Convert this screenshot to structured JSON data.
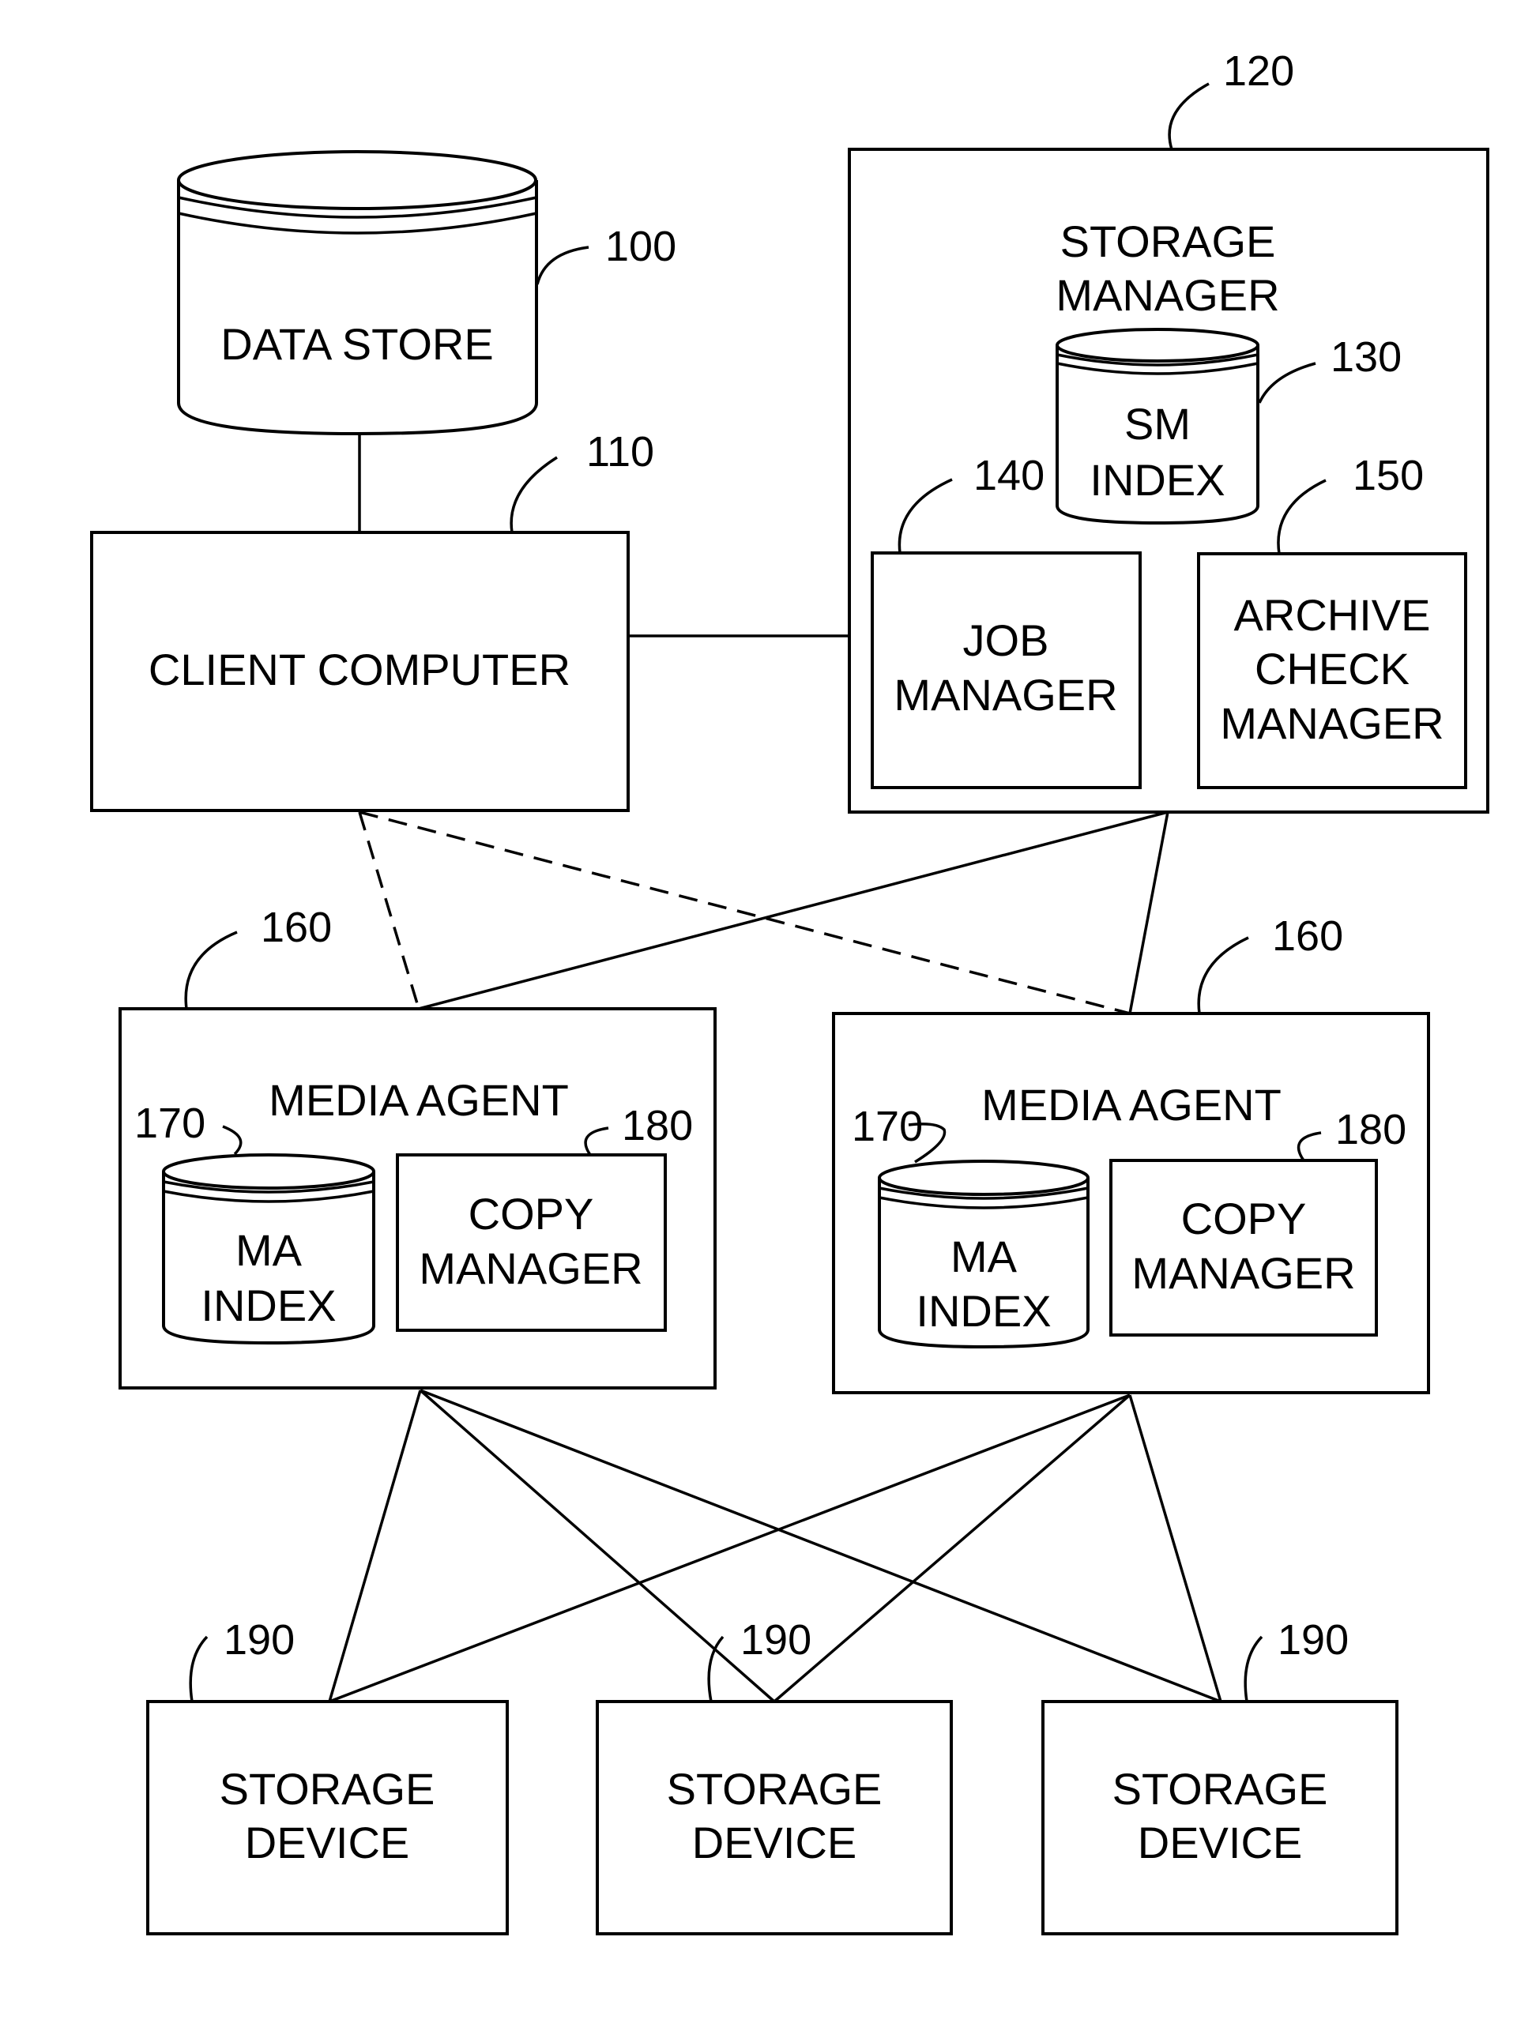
{
  "diagram": {
    "components": {
      "data_store": {
        "ref": "100",
        "lines": [
          "DATA STORE"
        ],
        "shape": "cylinder"
      },
      "client_computer": {
        "ref": "110",
        "lines": [
          "CLIENT COMPUTER"
        ],
        "shape": "box"
      },
      "storage_manager": {
        "ref": "120",
        "lines": [
          "STORAGE",
          "MANAGER"
        ],
        "shape": "box"
      },
      "sm_index": {
        "ref": "130",
        "lines": [
          "SM",
          "INDEX"
        ],
        "shape": "cylinder"
      },
      "job_manager": {
        "ref": "140",
        "lines": [
          "JOB",
          "MANAGER"
        ],
        "shape": "box"
      },
      "archive_check_manager": {
        "ref": "150",
        "lines": [
          "ARCHIVE",
          "CHECK",
          "MANAGER"
        ],
        "shape": "box"
      },
      "media_agent_left": {
        "ref": "160",
        "lines": [
          "MEDIA AGENT"
        ],
        "shape": "box"
      },
      "media_agent_right": {
        "ref": "160",
        "lines": [
          "MEDIA AGENT"
        ],
        "shape": "box"
      },
      "ma_index_left": {
        "ref": "170",
        "lines": [
          "MA",
          "INDEX"
        ],
        "shape": "cylinder"
      },
      "ma_index_right": {
        "ref": "170",
        "lines": [
          "MA",
          "INDEX"
        ],
        "shape": "cylinder"
      },
      "copy_manager_left": {
        "ref": "180",
        "lines": [
          "COPY",
          "MANAGER"
        ],
        "shape": "box"
      },
      "copy_manager_right": {
        "ref": "180",
        "lines": [
          "COPY",
          "MANAGER"
        ],
        "shape": "box"
      },
      "storage_device_1": {
        "ref": "190",
        "lines": [
          "STORAGE",
          "DEVICE"
        ],
        "shape": "box"
      },
      "storage_device_2": {
        "ref": "190",
        "lines": [
          "STORAGE",
          "DEVICE"
        ],
        "shape": "box"
      },
      "storage_device_3": {
        "ref": "190",
        "lines": [
          "STORAGE",
          "DEVICE"
        ],
        "shape": "box"
      }
    },
    "connections": [
      {
        "from": "data_store",
        "to": "client_computer",
        "style": "solid"
      },
      {
        "from": "client_computer",
        "to": "storage_manager",
        "style": "solid"
      },
      {
        "from": "client_computer",
        "to": "media_agent_left",
        "style": "dashed"
      },
      {
        "from": "client_computer",
        "to": "media_agent_right",
        "style": "dashed"
      },
      {
        "from": "storage_manager",
        "to": "media_agent_left",
        "style": "solid"
      },
      {
        "from": "storage_manager",
        "to": "media_agent_right",
        "style": "solid"
      },
      {
        "from": "media_agent_left",
        "to": "storage_device_1",
        "style": "solid"
      },
      {
        "from": "media_agent_left",
        "to": "storage_device_2",
        "style": "solid"
      },
      {
        "from": "media_agent_left",
        "to": "storage_device_3",
        "style": "solid"
      },
      {
        "from": "media_agent_right",
        "to": "storage_device_1",
        "style": "solid"
      },
      {
        "from": "media_agent_right",
        "to": "storage_device_2",
        "style": "solid"
      },
      {
        "from": "media_agent_right",
        "to": "storage_device_3",
        "style": "solid"
      }
    ]
  }
}
